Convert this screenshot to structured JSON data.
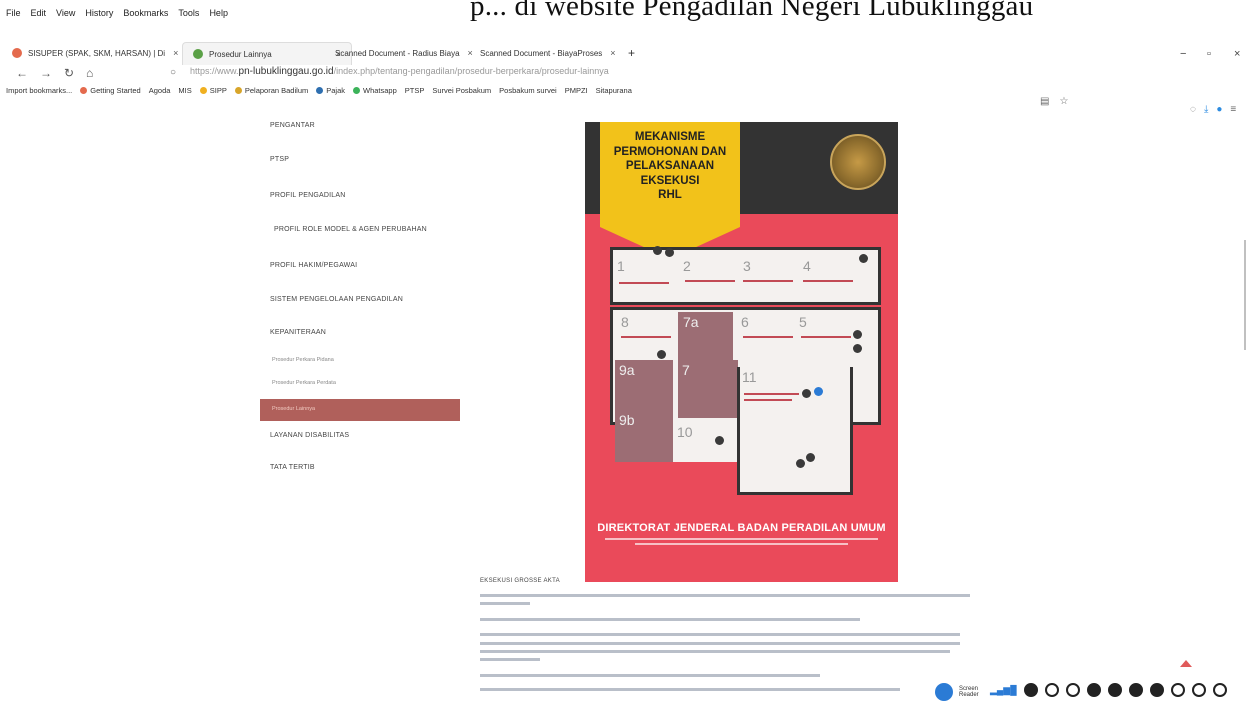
{
  "scan_title": "p... di website Pengadilan Negeri Lubuklinggau",
  "menubar": [
    "File",
    "Edit",
    "View",
    "History",
    "Bookmarks",
    "Tools",
    "Help"
  ],
  "tabs": [
    {
      "label": "SISUPER (SPAK, SKM, HARSAN) | Di"
    },
    {
      "label": "Prosedur Lainnya"
    },
    {
      "label": "Scanned Document - Radius Biaya"
    },
    {
      "label": "Scanned Document - BiayaProses"
    }
  ],
  "url": {
    "prefix": "https://www.",
    "domain": "pn-lubuklinggau.go.id",
    "path": "/index.php/tentang-pengadilan/prosedur-berperkara/prosedur-lainnya"
  },
  "bookmarks": [
    "Import bookmarks...",
    "Getting Started",
    "Agoda",
    "MIS",
    "SIPP",
    "Pelaporan Badilum",
    "Pajak",
    "Whatsapp",
    "PTSP",
    "Survei Posbakum",
    "Posbakum survei",
    "PMPZI",
    "Sitapurana"
  ],
  "sidebar": {
    "items": [
      "PENGANTAR",
      "PTSP",
      "PROFIL PENGADILAN",
      "PROFIL ROLE MODEL & AGEN PERUBAHAN",
      "PROFIL HAKIM/PEGAWAI",
      "SISTEM PENGELOLAAN PENGADILAN",
      "KEPANITERAAN"
    ],
    "subitems": [
      "Prosedur Perkara Pidana",
      "Prosedur Perkara Perdata"
    ],
    "active": "Prosedur Lainnya",
    "after": [
      "LAYANAN DISABILITAS",
      "TATA TERTIB"
    ]
  },
  "poster": {
    "title": [
      "MEKANISME",
      "PERMOHONAN DAN",
      "PELAKSANAAN",
      "EKSEKUSI",
      "RHL"
    ],
    "steps": [
      "1",
      "2",
      "3",
      "4",
      "8",
      "7a",
      "6",
      "5",
      "9a",
      "7",
      "11",
      "9b",
      "10"
    ],
    "footer": "DIREKTORAT JENDERAL BADAN PERADILAN UMUM"
  },
  "content": {
    "heading": "EKSEKUSI GROSSE AKTA"
  },
  "reader": {
    "label1": "Screen",
    "label2": "Reader"
  },
  "colors": {
    "active_menu": "#b0605b",
    "poster_red": "#ea4a5a",
    "poster_yellow": "#f2c21a"
  }
}
